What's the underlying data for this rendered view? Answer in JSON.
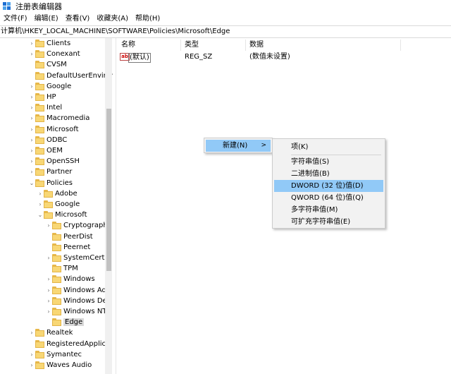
{
  "window": {
    "title": "注册表编辑器"
  },
  "menu": [
    "文件(F)",
    "编辑(E)",
    "查看(V)",
    "收藏夹(A)",
    "帮助(H)"
  ],
  "address": "计算机\\HKEY_LOCAL_MACHINE\\SOFTWARE\\Policies\\Microsoft\\Edge",
  "tree": [
    {
      "label": "Clients",
      "chevron": "›"
    },
    {
      "label": "Conexant",
      "chevron": "›"
    },
    {
      "label": "CVSM",
      "chevron": ""
    },
    {
      "label": "DefaultUserEnviron",
      "chevron": ""
    },
    {
      "label": "Google",
      "chevron": "›"
    },
    {
      "label": "HP",
      "chevron": "›"
    },
    {
      "label": "Intel",
      "chevron": "›"
    },
    {
      "label": "Macromedia",
      "chevron": "›"
    },
    {
      "label": "Microsoft",
      "chevron": "›"
    },
    {
      "label": "ODBC",
      "chevron": "›"
    },
    {
      "label": "OEM",
      "chevron": "›"
    },
    {
      "label": "OpenSSH",
      "chevron": "›"
    },
    {
      "label": "Partner",
      "chevron": "›"
    },
    {
      "label": "Policies",
      "chevron": "⌄"
    },
    {
      "label": "Adobe",
      "chevron": "›"
    },
    {
      "label": "Google",
      "chevron": "›"
    },
    {
      "label": "Microsoft",
      "chevron": "⌄"
    },
    {
      "label": "Cryptography",
      "chevron": "›"
    },
    {
      "label": "PeerDist",
      "chevron": ""
    },
    {
      "label": "Peernet",
      "chevron": ""
    },
    {
      "label": "SystemCertifi",
      "chevron": "›"
    },
    {
      "label": "TPM",
      "chevron": ""
    },
    {
      "label": "Windows",
      "chevron": "›"
    },
    {
      "label": "Windows Adv",
      "chevron": "›"
    },
    {
      "label": "Windows Def",
      "chevron": "›"
    },
    {
      "label": "Windows NT",
      "chevron": "›"
    },
    {
      "label": "Edge",
      "chevron": ""
    },
    {
      "label": "Realtek",
      "chevron": "›"
    },
    {
      "label": "RegisteredApplica",
      "chevron": ""
    },
    {
      "label": "Symantec",
      "chevron": "›"
    },
    {
      "label": "Waves Audio",
      "chevron": "›"
    }
  ],
  "list": {
    "headers": {
      "name": "名称",
      "type": "类型",
      "data": "数据"
    },
    "row": {
      "icon": "ab",
      "name": "(默认)",
      "type": "REG_SZ",
      "data": "(数值未设置)"
    }
  },
  "context_menu": {
    "new_label": "新建(N)",
    "new_arrow": ">",
    "submenu": {
      "key": "项(K)",
      "string": "字符串值(S)",
      "binary": "二进制值(B)",
      "dword": "DWORD (32 位)值(D)",
      "qword": "QWORD (64 位)值(Q)",
      "multi_string": "多字符串值(M)",
      "expandable_string": "可扩充字符串值(E)"
    }
  }
}
